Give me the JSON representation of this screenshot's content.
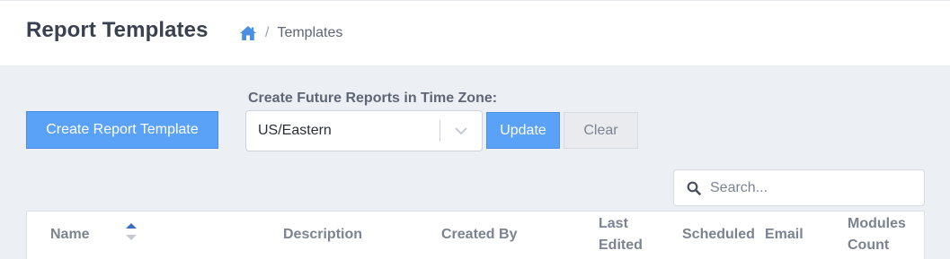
{
  "header": {
    "title": "Report Templates",
    "breadcrumb": {
      "home_icon": "home-icon",
      "separator": "/",
      "current": "Templates"
    }
  },
  "toolbar": {
    "create_label": "Create Report Template",
    "timezone_label": "Create Future Reports in Time Zone:",
    "timezone_value": "US/Eastern",
    "update_label": "Update",
    "clear_label": "Clear"
  },
  "search": {
    "placeholder": "Search...",
    "value": ""
  },
  "table": {
    "columns": {
      "name": "Name",
      "description": "Description",
      "created_by": "Created By",
      "last_edited_1": "Last",
      "last_edited_2": "Edited",
      "scheduled": "Scheduled",
      "email": "Email",
      "modules_1": "Modules",
      "modules_2": "Count"
    },
    "sort": {
      "column": "Name",
      "direction": "ascending"
    }
  },
  "colors": {
    "primary": "#5aa2f7",
    "sort_active": "#3b6fc4",
    "page_bg": "#eceff4"
  }
}
